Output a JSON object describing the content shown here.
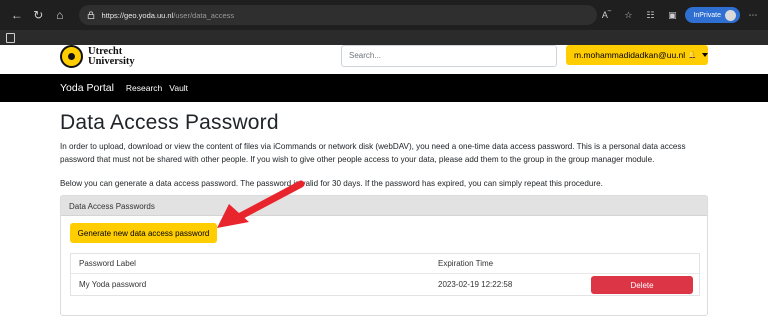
{
  "browser": {
    "url_host": "https://geo.yoda.uu.nl",
    "url_path": "/user/data_access",
    "inprivate_label": "InPrivate"
  },
  "header": {
    "logo_line1": "Utrecht",
    "logo_line2": "University",
    "search_placeholder": "Search...",
    "user_email": "m.mohammadidadkan@uu.nl"
  },
  "navbar": {
    "brand": "Yoda Portal",
    "links": [
      "Research",
      "Vault"
    ]
  },
  "main": {
    "title": "Data Access Password",
    "intro": "In order to upload, download or view the content of files via iCommands or network disk (webDAV), you need a one-time data access password. This is a personal data access password that must not be shared with other people. If you wish to give other people access to your data, please add them to the group in the group manager module.",
    "info": "Below you can generate a data access password. The password is valid for 30 days. If the password has expired, you can simply repeat this procedure.",
    "card_title": "Data Access Passwords",
    "generate_label": "Generate new data access password",
    "table": {
      "headers": [
        "Password Label",
        "Expiration Time"
      ],
      "rows": [
        {
          "label": "My Yoda password",
          "expires": "2023-02-19 12:22:58",
          "action": "Delete"
        }
      ]
    }
  },
  "colors": {
    "accent": "#ffcd00",
    "danger": "#dc3545",
    "annotation_arrow": "#e8242c"
  },
  "icons": [
    "back-icon",
    "refresh-icon",
    "home-icon",
    "lock-icon",
    "read-aloud-icon",
    "favorite-icon",
    "collections-icon",
    "extensions-icon",
    "more-icon",
    "bell-icon",
    "file-icon"
  ]
}
